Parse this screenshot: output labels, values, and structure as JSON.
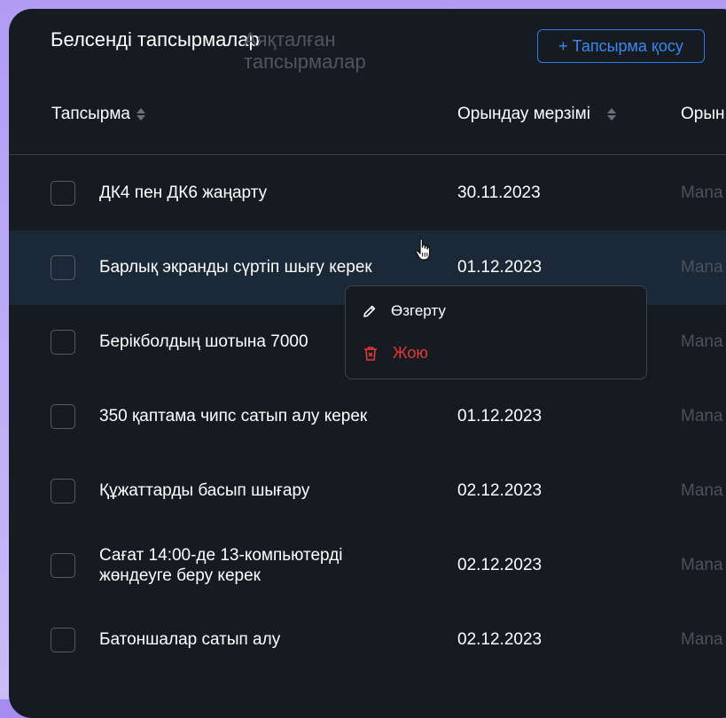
{
  "tabs": {
    "active": "Белсенді тапсырмалар",
    "inactive": "Аяқталған тапсырмалар"
  },
  "add_button": "+ Тапсырма қосу",
  "columns": {
    "task": "Тапсырма",
    "date": "Орындау мерзімі",
    "executor": "Орын"
  },
  "rows": [
    {
      "task": "ДК4 пен ДК6 жаңарту",
      "date": "30.11.2023",
      "executor": "Mana"
    },
    {
      "task": "Барлық экранды сүртіп шығу керек",
      "date": "01.12.2023",
      "executor": "Mana"
    },
    {
      "task": "Берікболдың шотына 7000",
      "date": "",
      "executor": "Mana"
    },
    {
      "task": "350 қаптама чипс сатып алу керек",
      "date": "01.12.2023",
      "executor": "Mana"
    },
    {
      "task": "Құжаттарды басып шығару",
      "date": "02.12.2023",
      "executor": "Mana"
    },
    {
      "task": "Сағат 14:00-де 13-компьютерді жөндеуге беру керек",
      "date": "02.12.2023",
      "executor": "Mana"
    },
    {
      "task": "Батоншалар сатып алу",
      "date": "02.12.2023",
      "executor": "Mana"
    }
  ],
  "context_menu": {
    "edit": "Өзгерту",
    "delete": "Жою"
  },
  "colors": {
    "accent": "#2c7be5",
    "danger": "#e5383b",
    "background": "#161b22",
    "hover_row": "#1b2837"
  }
}
